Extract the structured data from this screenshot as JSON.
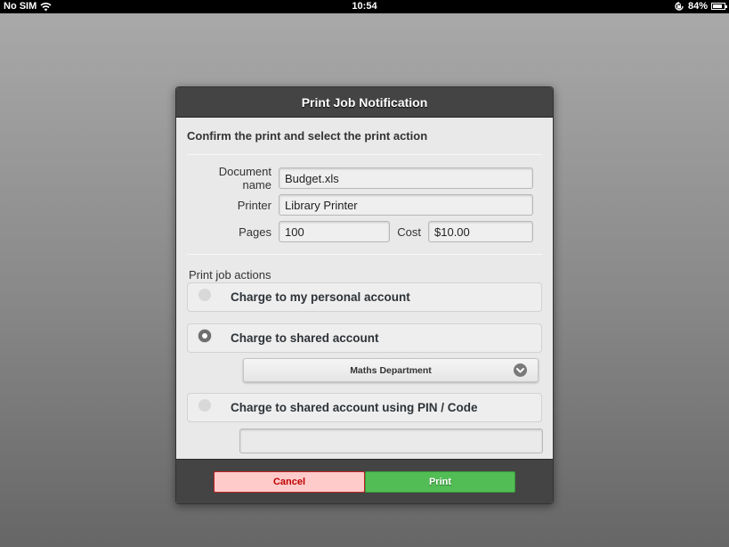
{
  "status_bar": {
    "carrier": "No SIM",
    "time": "10:54",
    "battery_percent": "84%",
    "battery_level": 0.84,
    "icons": [
      "wifi-icon",
      "rotation-lock-icon",
      "battery-icon"
    ]
  },
  "dialog": {
    "title": "Print Job Notification",
    "subtitle": "Confirm the print and select the print action",
    "fields": {
      "document_name": {
        "label": "Document name",
        "value": "Budget.xls"
      },
      "printer": {
        "label": "Printer",
        "value": "Library Printer"
      },
      "pages": {
        "label": "Pages",
        "value": "100"
      },
      "cost": {
        "label": "Cost",
        "value": "$10.00"
      }
    },
    "actions_label": "Print job actions",
    "options": [
      {
        "label": "Charge to my personal account",
        "selected": false
      },
      {
        "label": "Charge to shared account",
        "selected": true
      },
      {
        "label": "Charge to shared account using PIN / Code",
        "selected": false
      }
    ],
    "shared_account_select": {
      "value": "Maths Department",
      "icon": "chevron-down-icon"
    },
    "pin_code_input": {
      "value": "",
      "placeholder": ""
    },
    "buttons": {
      "cancel": "Cancel",
      "print": "Print"
    }
  },
  "colors": {
    "header_bg": "#444444",
    "cancel_bg": "#ffcaca",
    "cancel_text": "#c00000",
    "print_bg": "#52bd54"
  }
}
